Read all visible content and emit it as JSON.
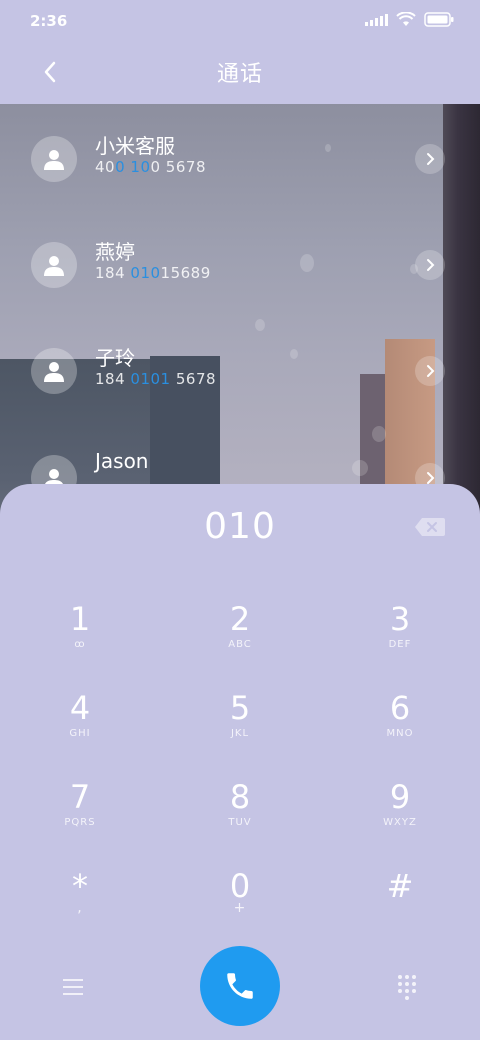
{
  "status_bar": {
    "time": "2:36"
  },
  "header": {
    "title": "通话"
  },
  "contacts": [
    {
      "name": "小米客服",
      "number_pre": "40",
      "number_hl": "0 10",
      "number_post": "0 5678"
    },
    {
      "name": "燕婷",
      "number_pre": "184 ",
      "number_hl": "010",
      "number_post": "15689"
    },
    {
      "name": "子玲",
      "number_pre": "184 ",
      "number_hl": "0101",
      "number_post": " 5678"
    },
    {
      "name": "Jason",
      "number_pre": "",
      "number_hl": "",
      "number_post": ""
    }
  ],
  "dialer": {
    "display": "010",
    "keys": [
      {
        "digit": "1",
        "letters": "ꝏ"
      },
      {
        "digit": "2",
        "letters": "ABC"
      },
      {
        "digit": "3",
        "letters": "DEF"
      },
      {
        "digit": "4",
        "letters": "GHI"
      },
      {
        "digit": "5",
        "letters": "JKL"
      },
      {
        "digit": "6",
        "letters": "MNO"
      },
      {
        "digit": "7",
        "letters": "PQRS"
      },
      {
        "digit": "8",
        "letters": "TUV"
      },
      {
        "digit": "9",
        "letters": "WXYZ"
      },
      {
        "digit": "*",
        "letters": ","
      },
      {
        "digit": "0",
        "letters": "+"
      },
      {
        "digit": "#",
        "letters": ""
      }
    ]
  },
  "colors": {
    "panel": "#c5c4e4",
    "accent": "#1f9bf0",
    "highlight": "#2a8fe0"
  },
  "icons": {
    "back": "chevron-left-icon",
    "contact": "person-icon",
    "arrow": "chevron-right-icon",
    "delete": "backspace-icon",
    "menu": "menu-icon",
    "call": "phone-icon",
    "keypad": "keypad-icon"
  }
}
